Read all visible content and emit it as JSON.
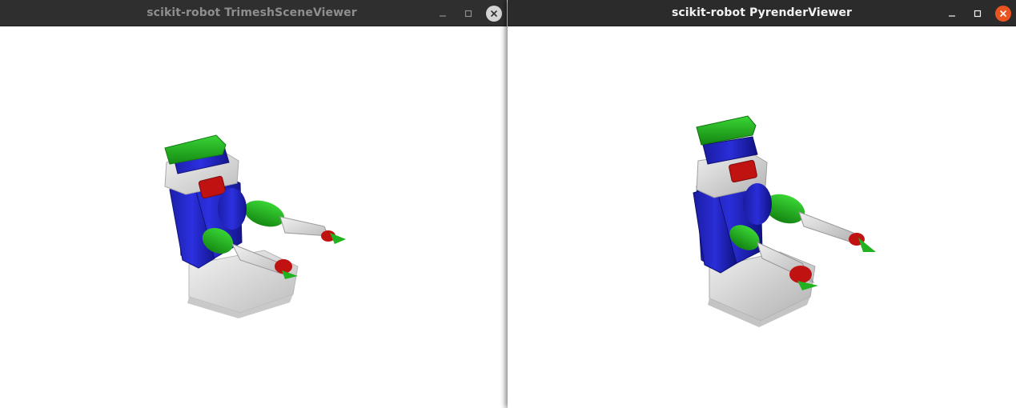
{
  "windows": [
    {
      "title": "scikit-robot TrimeshSceneViewer",
      "controls": {
        "minimize": "minimize-icon",
        "maximize": "maximize-icon",
        "close": "close-icon"
      },
      "scene": {
        "background": "#ffffff",
        "model": "pr2-robot"
      }
    },
    {
      "title": "scikit-robot PyrenderViewer",
      "controls": {
        "minimize": "minimize-icon",
        "maximize": "maximize-icon",
        "close": "close-icon"
      },
      "scene": {
        "background": "#ffffff",
        "model": "pr2-robot"
      }
    }
  ],
  "colors": {
    "titlebar_inactive": "#2f2f2f",
    "titlebar_active": "#2b2b2b",
    "close_active": "#e95420",
    "robot_green": "#22b11f",
    "robot_blue": "#1f23c4",
    "robot_red": "#c11212",
    "robot_grey": "#d9d9d9"
  }
}
